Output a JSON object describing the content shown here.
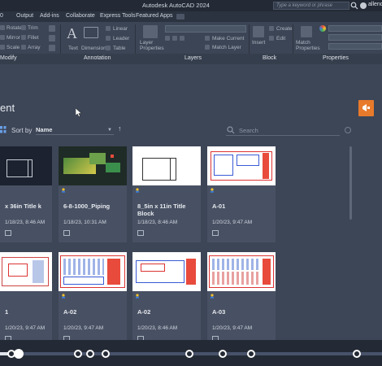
{
  "app": {
    "title": "Autodesk AutoCAD 2024",
    "search_placeholder": "Type a keyword or phrase",
    "user_name": "allend"
  },
  "menu_tabs": [
    "0",
    "Output",
    "Add-ins",
    "Collaborate",
    "Express Tools",
    "Featured Apps"
  ],
  "ribbon": {
    "modify_items": [
      "Rotate",
      "Mirror",
      "Scale",
      "Trim",
      "Fillet",
      "Array"
    ],
    "annotation_items": [
      "Text",
      "Dimension",
      "Linear",
      "Leader",
      "Table"
    ],
    "layers_items": [
      "Layer Properties",
      "Make Current",
      "Match Layer"
    ],
    "block_items": [
      "Insert",
      "Create",
      "Edit"
    ],
    "properties_items": [
      "Match Properties"
    ],
    "panels": [
      "Modify",
      "Annotation",
      "Layers",
      "Block",
      "Properties"
    ]
  },
  "page": {
    "title": "ent",
    "sort_label": "Sort by",
    "sort_value": "Name",
    "search_placeholder": "Search"
  },
  "cards_row1": [
    {
      "name": "x 36in Title k",
      "date": "1/18/23, 8:46 AM"
    },
    {
      "name": "6-8-1000_Piping",
      "date": "1/18/23, 10:31 AM"
    },
    {
      "name": "8_5in x 11in Title Block",
      "date": "1/18/23, 8:46 AM"
    },
    {
      "name": "A-01",
      "date": "1/20/23, 9:47 AM"
    }
  ],
  "cards_row2": [
    {
      "name": "1",
      "date": "1/20/23, 9:47 AM"
    },
    {
      "name": "A-02",
      "date": "1/20/23, 9:47 AM"
    },
    {
      "name": "A-02",
      "date": "1/20/23, 8:46 AM"
    },
    {
      "name": "A-03",
      "date": "1/20/23, 9:47 AM"
    }
  ],
  "colors": {
    "accent": "#e87a2c",
    "background": "#3d4657",
    "card": "#485163"
  }
}
